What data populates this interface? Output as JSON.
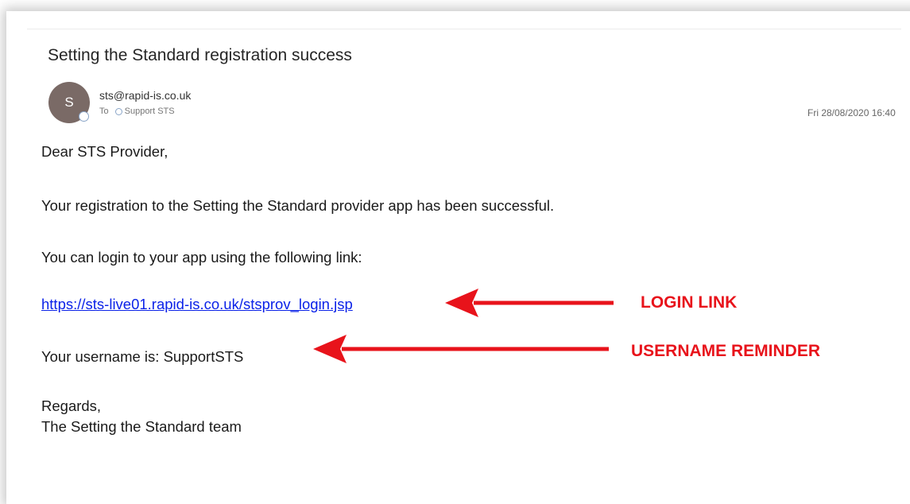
{
  "email": {
    "subject": "Setting the Standard registration success",
    "avatar_initial": "S",
    "sender": "sts@rapid-is.co.uk",
    "to_label": "To",
    "recipient": "Support STS",
    "datetime": "Fri 28/08/2020 16:40",
    "body": {
      "greeting": "Dear STS Provider,",
      "line1": "Your registration to the Setting the Standard provider app has been successful.",
      "line2": "You can login to your app using the following link:",
      "link": "https://sts-live01.rapid-is.co.uk/stsprov_login.jsp",
      "username_line": "Your username is: SupportSTS",
      "closing": "Regards,",
      "signature": "The Setting the Standard team"
    }
  },
  "annotations": {
    "login_label": "LOGIN LINK",
    "username_label": "USERNAME REMINDER",
    "color": "#e8131b"
  },
  "colors": {
    "link": "#0b22e8",
    "avatar": "#7a6a66"
  }
}
